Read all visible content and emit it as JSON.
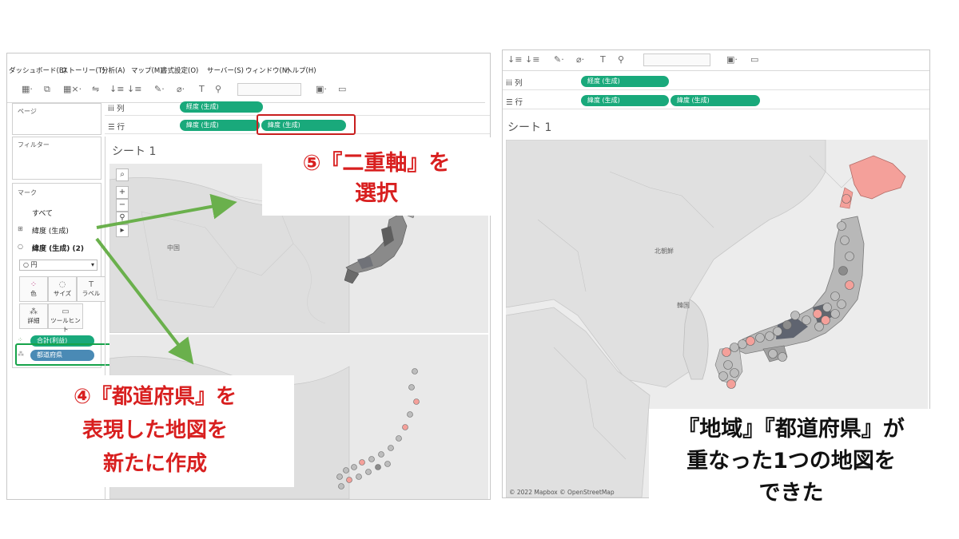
{
  "left": {
    "menu": [
      "ダッシュボード(B)",
      "ストーリー(T)",
      "分析(A)",
      "マップ(M)",
      "書式設定(O)",
      "サーバー(S)",
      "ウィンドウ(N)",
      "ヘルプ(H)"
    ],
    "pages_label": "ページ",
    "filters_label": "フィルター",
    "marks_label": "マーク",
    "marks_items": {
      "all": "すべて",
      "lat1": "緯度 (生成)",
      "lat2": "緯度 (生成) (2)"
    },
    "mark_type": "円",
    "mark_buttons": {
      "color": "色",
      "size": "サイズ",
      "label": "ラベル",
      "detail": "詳細",
      "tooltip": "ツールヒント"
    },
    "mark_pills": {
      "profit": "合計(利益)",
      "prefecture": "都道府県"
    },
    "columns_label": "列",
    "rows_label": "行",
    "columns_pill": "経度 (生成)",
    "rows_pill1": "緯度 (生成)",
    "rows_pill2": "緯度 (生成)",
    "sheet_title": "シート 1",
    "map_label_china": "中国",
    "callout5_line1": "⑤『二重軸』を",
    "callout5_line2": "選択",
    "callout4_line1": "④『都道府県』を",
    "callout4_line2": "表現した地図を",
    "callout4_line3": "新たに作成"
  },
  "right": {
    "columns_label": "列",
    "rows_label": "行",
    "columns_pill": "経度 (生成)",
    "rows_pill1": "緯度 (生成)",
    "rows_pill2": "緯度 (生成)",
    "sheet_title": "シート 1",
    "map_label_nk": "北朝鮮",
    "map_label_korea": "韓国",
    "copyright": "© 2022 Mapbox © OpenStreetMap",
    "caption_line1": "『地域』『都道府県』が",
    "caption_line2": "重なった1つの地図を",
    "caption_line3": "できた"
  },
  "colors": {
    "pill_green": "#19a97b",
    "pill_blue": "#4a8ab5",
    "highlight_red": "#c81e1e",
    "highlight_green": "#16a34a",
    "arrow_green": "#6ab04c",
    "callout_red": "#d81f1f",
    "hokkaido_pink": "#f4a09a"
  }
}
